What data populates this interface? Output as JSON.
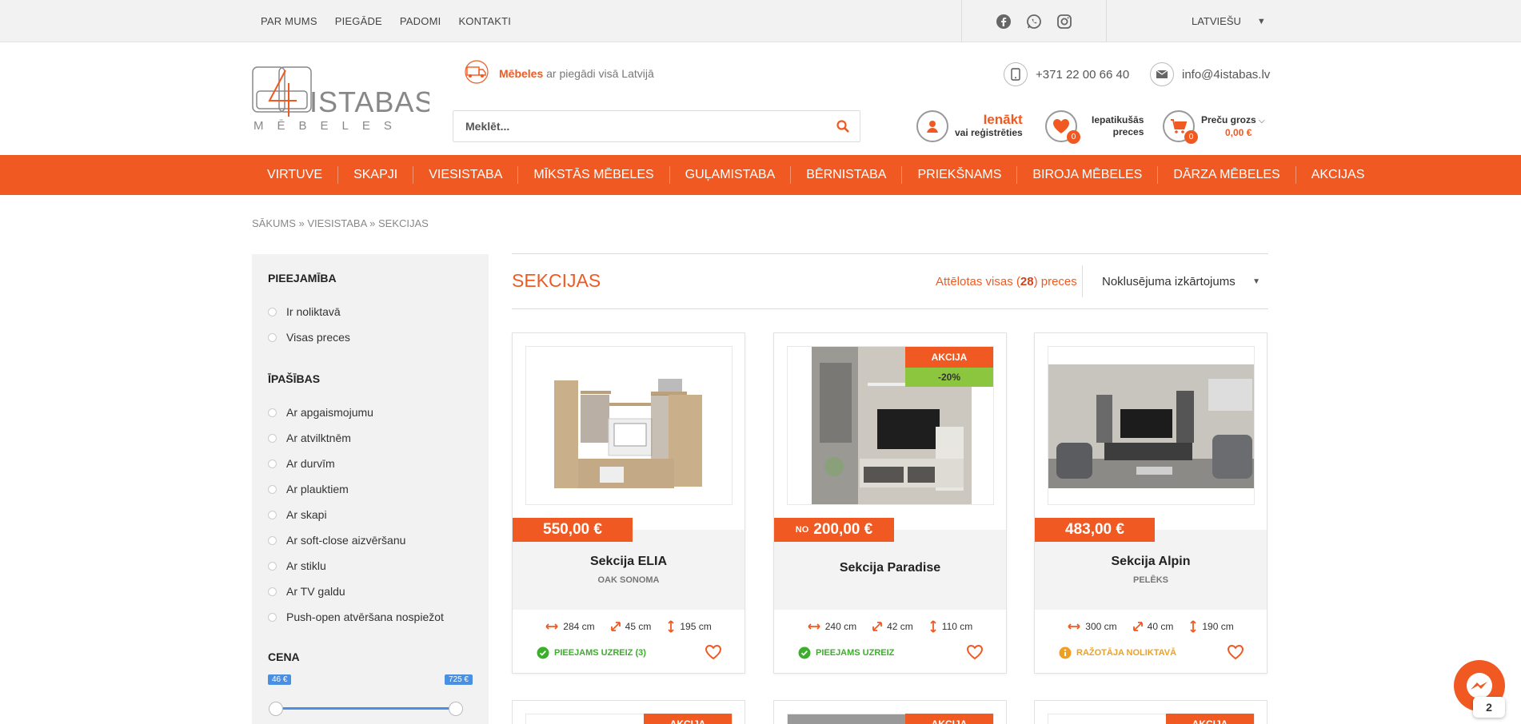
{
  "topnav": [
    "PAR MUMS",
    "PIEGĀDE",
    "PADOMI",
    "KONTAKTI"
  ],
  "language": "LATVIEŠU",
  "delivery": {
    "strong": "Mēbeles",
    "rest": "ar piegādi visā Latvijā"
  },
  "search": {
    "placeholder": "Meklēt..."
  },
  "contacts": {
    "phone": "+371 22 00 66 40",
    "email": "info@4istabas.lv"
  },
  "login": {
    "line1": "Ienākt",
    "line2": "vai reģistrēties"
  },
  "favorites": {
    "line1": "Iepatikušās",
    "line2": "preces",
    "count": "0"
  },
  "cart": {
    "line1": "Preču grozs",
    "price": "0,00 €",
    "count": "0"
  },
  "mainnav": [
    "VIRTUVE",
    "SKAPJI",
    "VIESISTABA",
    "MĪKSTĀS MĒBELES",
    "GUĻAMISTABA",
    "BĒRNISTABA",
    "PRIEKŠNAMS",
    "BIROJA MĒBELES",
    "DĀRZA MĒBELES",
    "AKCIJAS"
  ],
  "breadcrumb": "SĀKUMS » VIESISTABA » SEKCIJAS",
  "sidebar": {
    "availability_title": "PIEEJAMĪBA",
    "availability": [
      "Ir noliktavā",
      "Visas preces"
    ],
    "props_title": "ĪPAŠĪBAS",
    "props": [
      "Ar apgaismojumu",
      "Ar atvilktnēm",
      "Ar durvīm",
      "Ar plauktiem",
      "Ar skapi",
      "Ar soft-close aizvēršanu",
      "Ar stiklu",
      "Ar TV galdu",
      "Push-open atvēršana nospiežot"
    ],
    "price_title": "CENA",
    "price_min": "46 €",
    "price_max": "725 €"
  },
  "content": {
    "title": "SEKCIJAS",
    "showing_pre": "Attēlotas visas (",
    "showing_count": "28",
    "showing_post": ") preces",
    "sort": "Noklusējuma izkārtojums"
  },
  "products": [
    {
      "price": "550,00 €",
      "prefix": "",
      "name": "Sekcija ELIA",
      "color": "OAK SONOMA",
      "w": "284 cm",
      "d": "45 cm",
      "h": "195 cm",
      "avail": "PIEEJAMS UZREIZ (3)"
    },
    {
      "price": "200,00 €",
      "prefix": "NO",
      "name": "Sekcija Paradise",
      "color": "",
      "w": "240 cm",
      "d": "42 cm",
      "h": "110 cm",
      "avail": "PIEEJAMS UZREIZ",
      "badge": "AKCIJA",
      "discount": "-20%"
    },
    {
      "price": "483,00 €",
      "prefix": "",
      "name": "Sekcija Alpin",
      "color": "PELĒKS",
      "w": "300 cm",
      "d": "40 cm",
      "h": "190 cm",
      "avail": "RAŽOTĀJA NOLIKTAVĀ"
    }
  ],
  "next_row_badge": "AKCIJA",
  "chat_count": "2",
  "colors": {
    "accent": "#f05a22",
    "green": "#8cc63f",
    "ok": "#3cae2b",
    "warn": "#f0a020"
  }
}
